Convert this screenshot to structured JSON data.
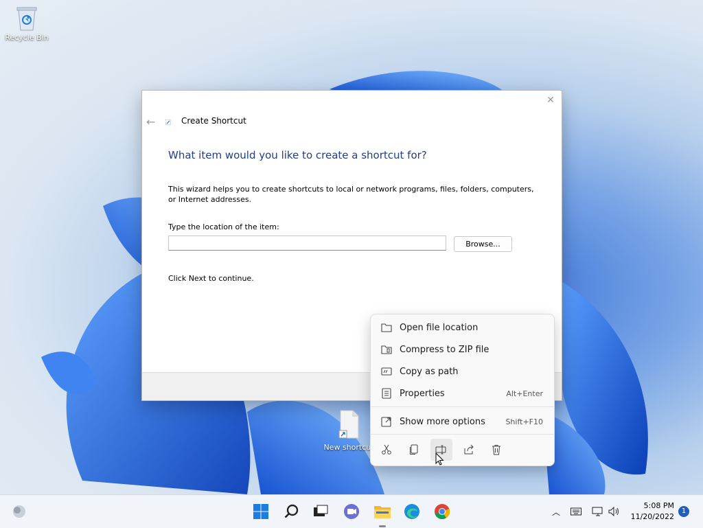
{
  "desktop": {
    "recycle_bin_label": "Recycle Bin",
    "shortcut_label": "New shortcut"
  },
  "dialog": {
    "title": "Create Shortcut",
    "heading": "What item would you like to create a shortcut for?",
    "description": "This wizard helps you to create shortcuts to local or network programs, files, folders, computers, or Internet addresses.",
    "location_label": "Type the location of the item:",
    "location_value": "",
    "browse_label": "Browse...",
    "next_hint": "Click Next to continue."
  },
  "context_menu": {
    "items": [
      {
        "label": "Open file location",
        "shortcut": "",
        "icon": "folder-icon"
      },
      {
        "label": "Compress to ZIP file",
        "shortcut": "",
        "icon": "zip-icon"
      },
      {
        "label": "Copy as path",
        "shortcut": "",
        "icon": "copy-path-icon"
      },
      {
        "label": "Properties",
        "shortcut": "Alt+Enter",
        "icon": "properties-icon"
      }
    ],
    "more_options": {
      "label": "Show more options",
      "shortcut": "Shift+F10",
      "icon": "more-options-icon"
    },
    "toolbar": [
      "cut-icon",
      "copy-icon",
      "rename-icon",
      "share-icon",
      "delete-icon"
    ]
  },
  "taskbar": {
    "apps": [
      "start-icon",
      "search-icon",
      "task-view-icon",
      "chat-icon",
      "file-explorer-icon",
      "edge-icon",
      "chrome-icon"
    ],
    "clock_time": "5:08 PM",
    "clock_date": "11/20/2022",
    "notification_count": "1"
  },
  "colors": {
    "heading": "#1f3d8a",
    "accent": "#1f5fbf"
  }
}
